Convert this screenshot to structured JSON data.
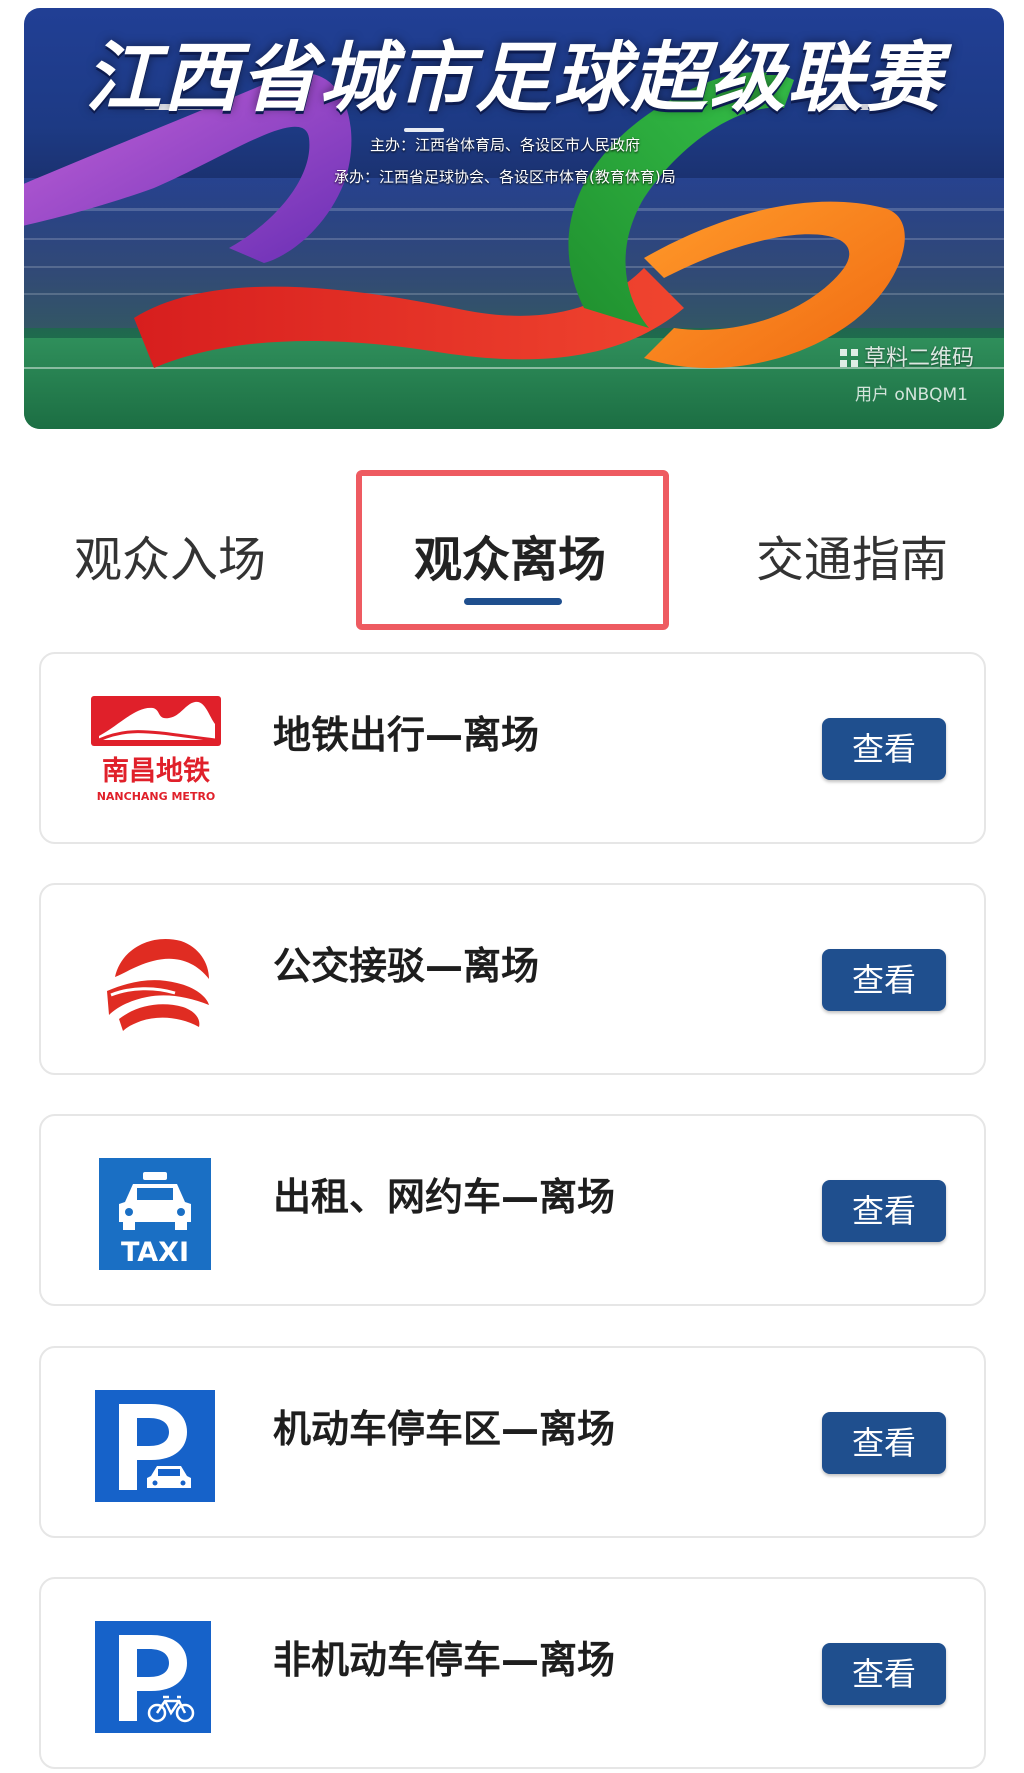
{
  "banner": {
    "title": "江西省城市足球超级联赛",
    "host": "主办：江西省体育局、各设区市人民政府",
    "organizer": "承办：江西省足球协会、各设区市体育(教育体育)局",
    "watermark": "草料二维码",
    "watermark_user": "用户 oNBQM1"
  },
  "tabs": [
    {
      "label": "观众入场",
      "active": false
    },
    {
      "label": "观众离场",
      "active": true
    },
    {
      "label": "交通指南",
      "active": false
    }
  ],
  "highlight_color": "#ee5b61",
  "accent_color": "#1f4f8e",
  "cards": [
    {
      "icon": "nanchang-metro-logo-icon",
      "logo_text": "南昌地铁",
      "logo_sub": "NANCHANG METRO",
      "label": "地铁出行—离场",
      "button": "查看"
    },
    {
      "icon": "bus-logo-icon",
      "label": "公交接驳—离场",
      "button": "查看"
    },
    {
      "icon": "taxi-sign-icon",
      "logo_text": "TAXI",
      "label": "出租、网约车—离场",
      "button": "查看"
    },
    {
      "icon": "car-parking-sign-icon",
      "label": "机动车停车区—离场",
      "button": "查看"
    },
    {
      "icon": "bicycle-parking-sign-icon",
      "label": "非机动车停车—离场",
      "button": "查看"
    }
  ]
}
